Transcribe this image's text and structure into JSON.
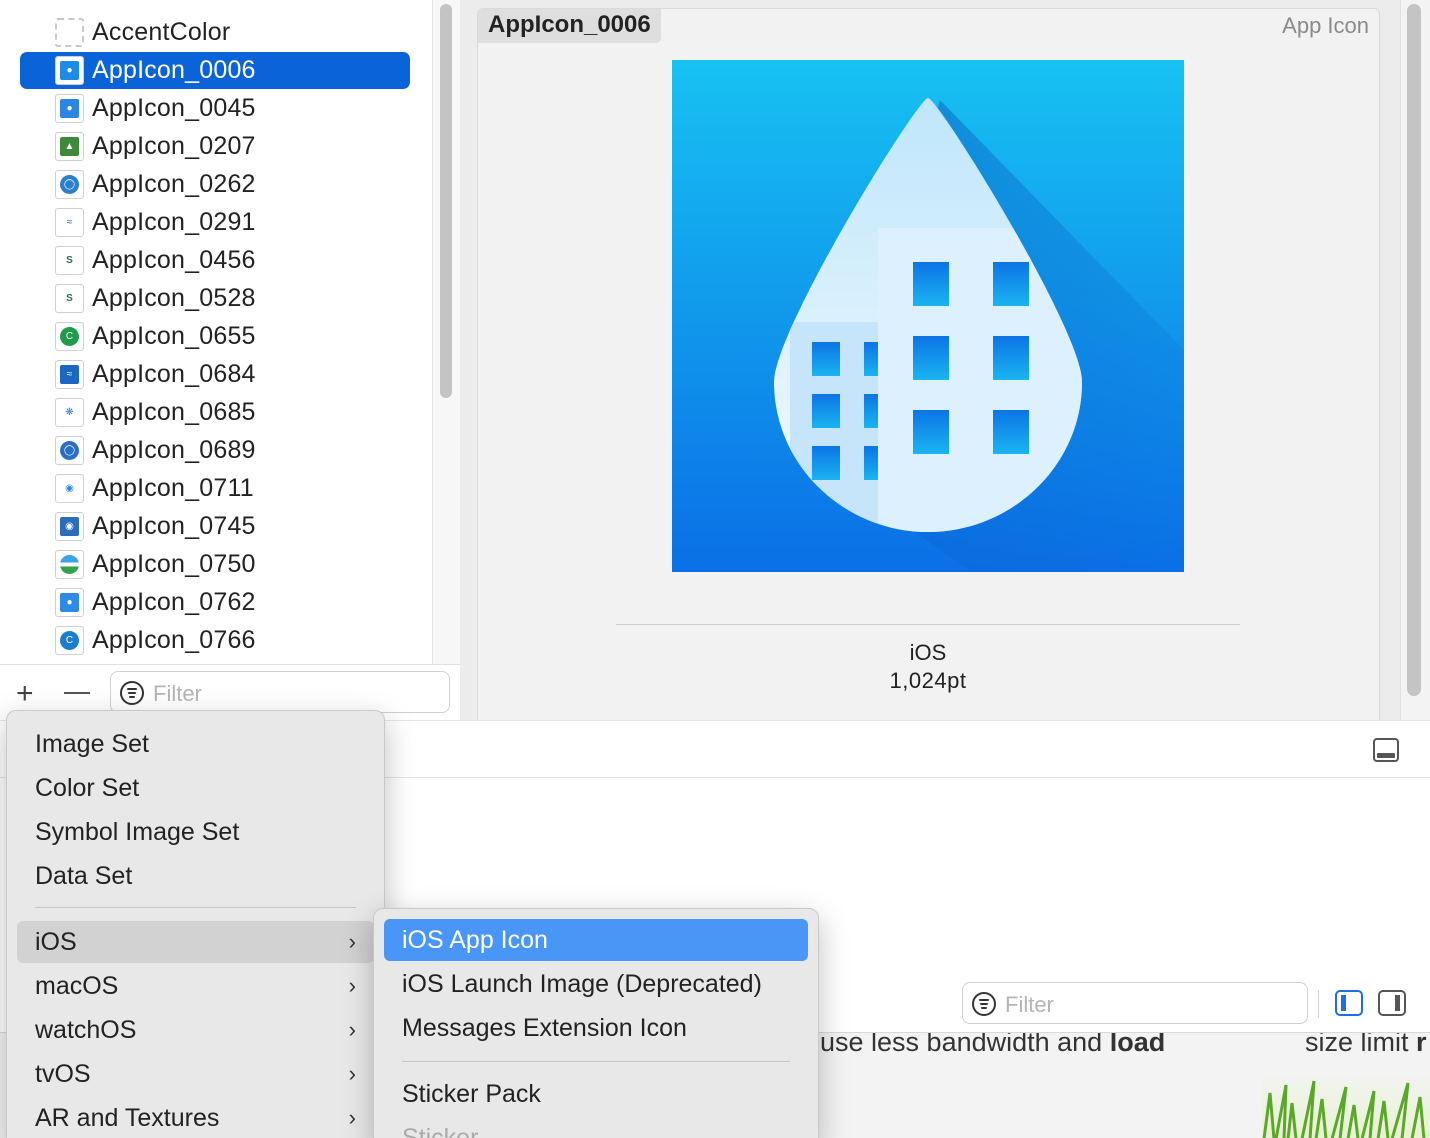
{
  "sidebar": {
    "items": [
      {
        "label": "AccentColor",
        "thumb": "dashed",
        "color": ""
      },
      {
        "label": "AppIcon_0006",
        "thumb": "drop",
        "color": "#1d8be8",
        "selected": true
      },
      {
        "label": "AppIcon_0045",
        "thumb": "drop",
        "color": "#2a86e0"
      },
      {
        "label": "AppIcon_0207",
        "thumb": "leaf",
        "color": "#3f8a3a"
      },
      {
        "label": "AppIcon_0262",
        "thumb": "globe",
        "color": "#2a7fcf"
      },
      {
        "label": "AppIcon_0291",
        "thumb": "wave",
        "color": "#ffffff"
      },
      {
        "label": "AppIcon_0456",
        "thumb": "text",
        "color": "#ffffff"
      },
      {
        "label": "AppIcon_0528",
        "thumb": "text",
        "color": "#ffffff"
      },
      {
        "label": "AppIcon_0655",
        "thumb": "ring",
        "color": "#1f9c4a"
      },
      {
        "label": "AppIcon_0684",
        "thumb": "sea",
        "color": "#1b67c2"
      },
      {
        "label": "AppIcon_0685",
        "thumb": "star",
        "color": "#ffffff"
      },
      {
        "label": "AppIcon_0689",
        "thumb": "circle",
        "color": "#2b6fc4"
      },
      {
        "label": "AppIcon_0711",
        "thumb": "eye",
        "color": "#ffffff"
      },
      {
        "label": "AppIcon_0745",
        "thumb": "badge",
        "color": "#2c6db8"
      },
      {
        "label": "AppIcon_0750",
        "thumb": "stripe",
        "color": "#ffffff"
      },
      {
        "label": "AppIcon_0762",
        "thumb": "drop",
        "color": "#2f8ae6"
      },
      {
        "label": "AppIcon_0766",
        "thumb": "ring",
        "color": "#1c7ccf"
      }
    ],
    "add_label": "+",
    "filter_placeholder": "Filter"
  },
  "editor": {
    "set_name": "AppIcon_0006",
    "set_kind": "App Icon",
    "platform": "iOS",
    "size": "1,024pt"
  },
  "lower": {
    "filter_placeholder": "Filter"
  },
  "backdrop": {
    "text_left_plain": "use less bandwidth and ",
    "text_left_bold": "load",
    "text_right_plain": "size limit ",
    "text_right_bold": "r"
  },
  "menu": {
    "items": [
      "Image Set",
      "Color Set",
      "Symbol Image Set",
      "Data Set"
    ],
    "platforms": [
      {
        "label": "iOS",
        "chevron": "›",
        "highlighted": true
      },
      {
        "label": "macOS",
        "chevron": "›"
      },
      {
        "label": "watchOS",
        "chevron": "›"
      },
      {
        "label": "tvOS",
        "chevron": "›"
      },
      {
        "label": "AR and Textures",
        "chevron": "›"
      }
    ]
  },
  "submenu": {
    "items": [
      "iOS App Icon",
      "iOS Launch Image (Deprecated)",
      "Messages Extension Icon"
    ],
    "items2": [
      "Sticker Pack",
      "Sticker"
    ]
  },
  "colors": {
    "selection": "#0a63d9",
    "menu_highlight": "#4a96f7",
    "icon_gradient_top": "#17c2f2",
    "icon_gradient_bottom": "#0a6fe6"
  }
}
